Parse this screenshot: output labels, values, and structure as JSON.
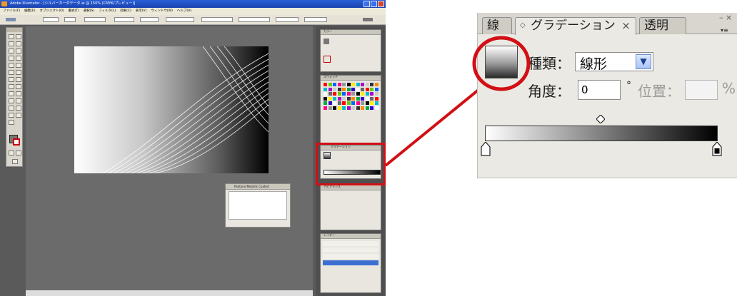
{
  "screenshot": {
    "window_title": "Adobe Illustrator - [シルバーカーダデータ.ai @ 150% (CMYK/プレビュー)]",
    "menu_items": [
      "ファイル(F)",
      "編集(E)",
      "オブジェクト(O)",
      "書式(T)",
      "選択(S)",
      "フィルタ(L)",
      "効果(C)",
      "表示(V)",
      "ウィンドウ(W)",
      "ヘルプ(H)"
    ],
    "floating_panel_title": "Pantone Metallic Coated",
    "dock_panel_titles": [
      "カラー",
      "スウォッチ",
      "グラデーション",
      "アピアランス",
      "レイヤー"
    ]
  },
  "gradient_panel": {
    "tabs": [
      {
        "label": "線",
        "active": false
      },
      {
        "label": "グラデーション",
        "active": true,
        "has_close": true,
        "close_glyph": "×",
        "diamond": "◇"
      },
      {
        "label": "透明",
        "active": false
      }
    ],
    "type_label": "種類：",
    "type_value": "線形",
    "angle_label": "角度：",
    "angle_value": "0",
    "degree_symbol": "°",
    "position_label": "位置：",
    "position_value": "",
    "percent_symbol": "%",
    "gradient_colors": [
      "#ffffff",
      "#000000"
    ],
    "stop_colors": [
      "#ffffff",
      "#000000"
    ],
    "highlight_color": "#d20f14"
  }
}
